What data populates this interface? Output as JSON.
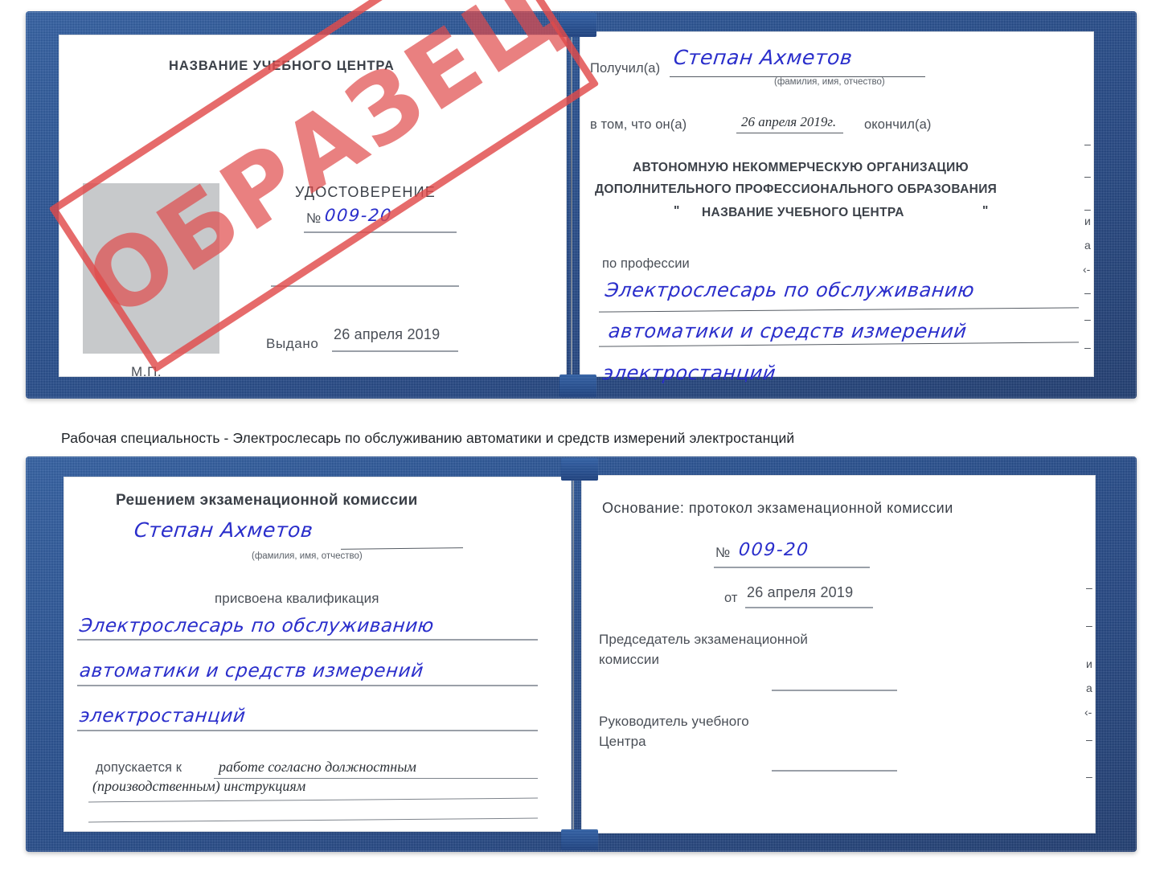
{
  "document": {
    "type": "certificate-scan",
    "language": "ru",
    "stamp_label": "ОБРАЗЕЦ",
    "stamp_color": "#e04a4a",
    "cover_color": "#1f4a8e",
    "ink_color": "#2a2ecb",
    "page_color": "#ffffff"
  },
  "caption": {
    "text": "Рабочая специальность - Электрослесарь по обслуживанию автоматики и средств измерений электростанций"
  },
  "certificate_top": {
    "left_page": {
      "center_name": "НАЗВАНИЕ УЧЕБНОГО ЦЕНТРА",
      "doc_title": "УДОСТОВЕРЕНИЕ",
      "number_label": "№",
      "number_value": "009-20",
      "issued_label": "Выдано",
      "issued_value": "26 апреля 2019",
      "seal_label": "М.П.",
      "photo_placeholder": "photo-box"
    },
    "right_page": {
      "received_label": "Получил(а)",
      "received_value": "Степан Ахметов",
      "fio_hint": "(фамилия, имя, отчество)",
      "in_that_label": "в том, что он(а)",
      "in_that_value": "26 апреля 2019г.",
      "finished_label": "окончил(а)",
      "org_line1": "АВТОНОМНУЮ НЕКОММЕРЧЕСКУЮ ОРГАНИЗАЦИЮ",
      "org_line2": "ДОПОЛНИТЕЛЬНОГО ПРОФЕССИОНАЛЬНОГО ОБРАЗОВАНИЯ",
      "org_quote_open": "\"",
      "org_line3": "НАЗВАНИЕ УЧЕБНОГО ЦЕНТРА",
      "org_quote_close": "\"",
      "profession_label": "по профессии",
      "profession_line1": "Электрослесарь по обслуживанию",
      "profession_line2": "автоматики и средств измерений",
      "profession_line3": "электростанций"
    }
  },
  "certificate_bottom": {
    "left_page": {
      "commission_decision": "Решением экзаменационной комиссии",
      "name_value": "Степан Ахметов",
      "fio_hint": "(фамилия, имя, отчество)",
      "qualification_label": "присвоена квалификация",
      "qualification_line1": "Электрослесарь по обслуживанию",
      "qualification_line2": "автоматики и средств измерений",
      "qualification_line3": "электростанций",
      "admitted_label": "допускается к",
      "admitted_value_line1": "работе согласно должностным",
      "admitted_value_line2": "(производственным) инструкциям"
    },
    "right_page": {
      "basis_label": "Основание: протокол экзаменационной комиссии",
      "number_label": "№",
      "number_value": "009-20",
      "date_label": "от",
      "date_value": "26 апреля 2019",
      "chairman_line1": "Председатель экзаменационной",
      "chairman_line2": "комиссии",
      "head_line1": "Руководитель учебного",
      "head_line2": "Центра"
    }
  },
  "edge_marks_top": [
    "–",
    "–",
    "–",
    "и",
    "а",
    "‹-",
    "–",
    "–",
    "–"
  ],
  "edge_marks_bottom": [
    "–",
    "–",
    "и",
    "а",
    "‹-",
    "–",
    "–"
  ]
}
